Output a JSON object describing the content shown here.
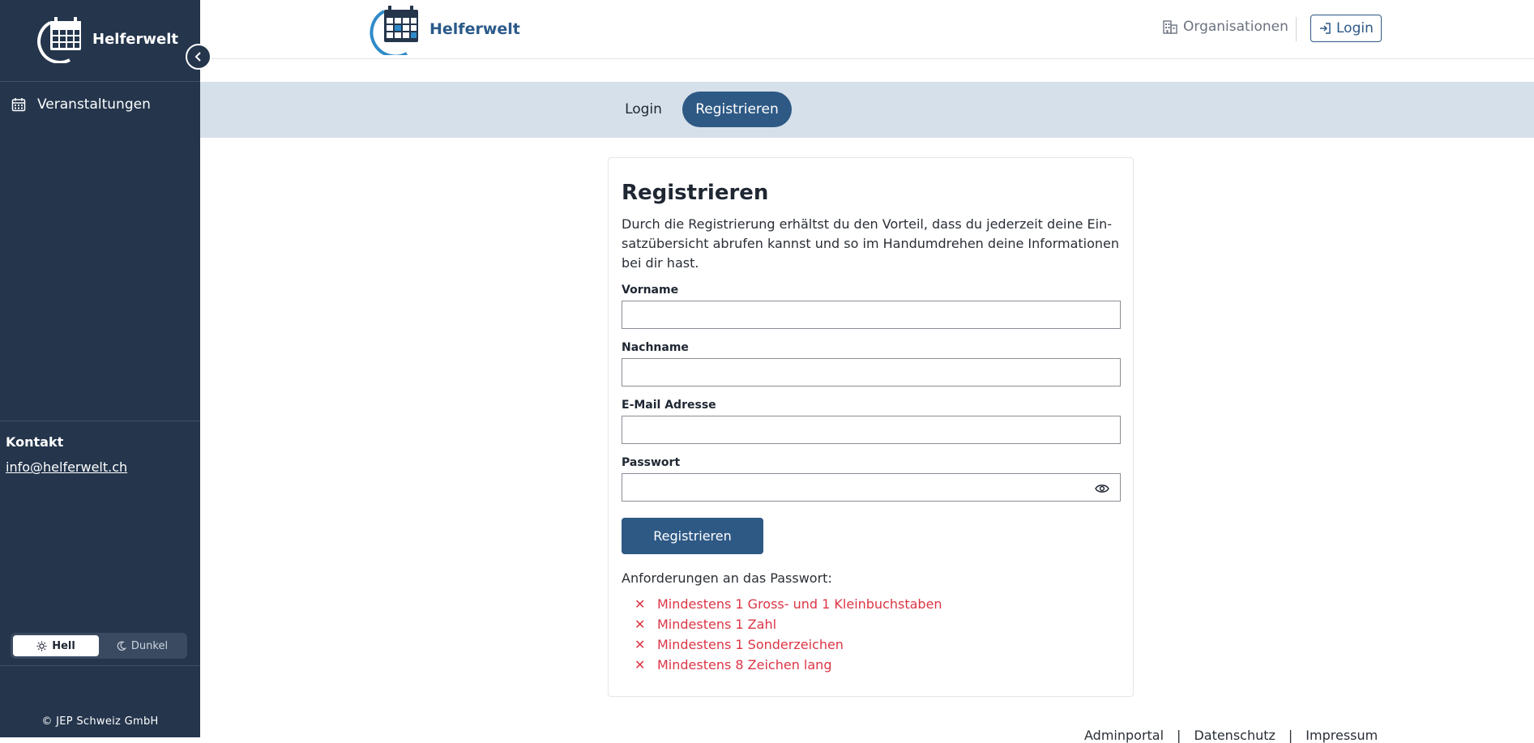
{
  "brand": {
    "name": "Helferwelt"
  },
  "sidebar": {
    "nav_items": [
      {
        "label": "Veranstaltungen",
        "icon": "calendar-icon"
      }
    ],
    "contact_heading": "Kontakt",
    "contact_email": "info@helferwelt.ch",
    "theme": {
      "light_label": "Hell",
      "dark_label": "Dunkel",
      "selected": "Hell"
    },
    "copyright": "© JEP Schweiz GmbH"
  },
  "header": {
    "organisations_label": "Organisationen",
    "login_label": "Login"
  },
  "tabs": {
    "login_label": "Login",
    "register_label": "Registrieren",
    "active": "Registrieren"
  },
  "form": {
    "title": "Registrieren",
    "description": "Durch die Registrierung erhältst du den Vorteil, dass du jederzeit deine Ein­satzübersicht abrufen kannst und so im Handumdrehen deine Informationen bei dir hast.",
    "fields": {
      "firstname_label": "Vorname",
      "lastname_label": "Nachname",
      "email_label": "E-Mail Adresse",
      "password_label": "Passwort"
    },
    "submit_label": "Registrieren",
    "requirements_heading": "Anforderungen an das Passwort:",
    "requirements": [
      "Mindestens 1 Gross- und 1 Kleinbuchstaben",
      "Mindestens 1 Zahl",
      "Mindestens 1 Sonderzeichen",
      "Mindestens 8 Zeichen lang"
    ]
  },
  "footer": {
    "links": [
      "Adminportal",
      "|",
      "Datenschutz",
      "|",
      "Impressum"
    ]
  },
  "colors": {
    "sidebar_bg": "#24354c",
    "primary": "#2e5985",
    "tab_band": "#d6e0ea",
    "error": "#dc3545"
  }
}
